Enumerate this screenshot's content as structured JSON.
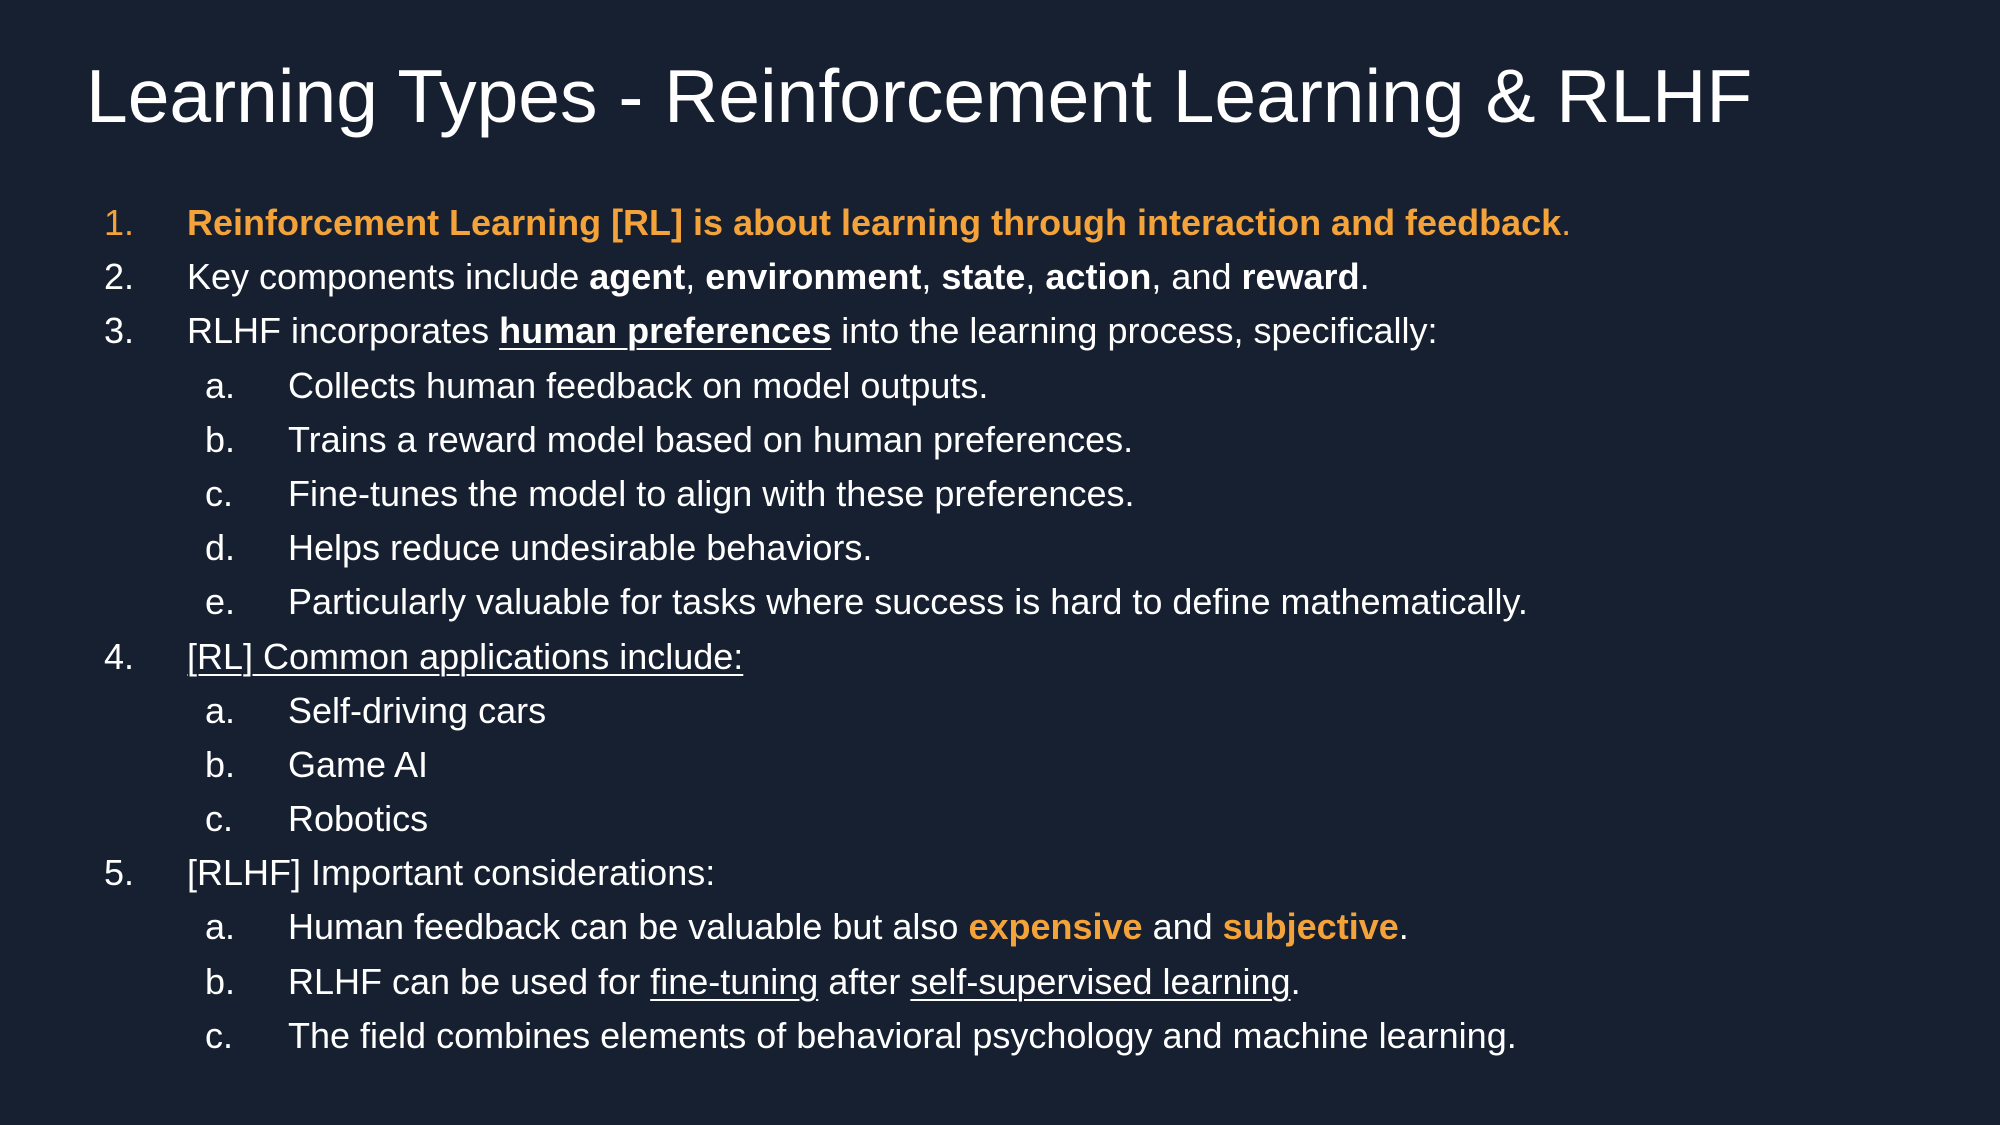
{
  "slide": {
    "title": "Learning Types - Reinforcement Learning & RLHF",
    "colors": {
      "background": "#172030",
      "text": "#ffffff",
      "accent": "#f4a33a"
    },
    "items": [
      {
        "num": "1.",
        "p0": "Reinforcement Learning [RL] is about learning through interaction and feedback",
        "p1": "."
      },
      {
        "num": "2.",
        "p0": "Key components include ",
        "p1": "agent",
        "p2": ", ",
        "p3": "environment",
        "p4": ", ",
        "p5": "state",
        "p6": ", ",
        "p7": "action",
        "p8": ", and ",
        "p9": "reward",
        "p10": "."
      },
      {
        "num": "3.",
        "p0": "RLHF incorporates ",
        "p1": "human preferences",
        "p2": " into the learning process, specifically:",
        "subs": [
          {
            "letter": "a.",
            "text": "Collects human feedback on model outputs."
          },
          {
            "letter": "b.",
            "text": "Trains a reward model based on human preferences."
          },
          {
            "letter": "c.",
            "text": "Fine-tunes the model to align with these preferences."
          },
          {
            "letter": "d.",
            "text": "Helps reduce undesirable behaviors."
          },
          {
            "letter": "e.",
            "text": "Particularly valuable for tasks where success is hard to define mathematically."
          }
        ]
      },
      {
        "num": "4.",
        "p0": "[RL] Common applications include:",
        "subs": [
          {
            "letter": "a.",
            "text": "Self-driving cars"
          },
          {
            "letter": "b.",
            "text": "Game AI"
          },
          {
            "letter": "c.",
            "text": "Robotics"
          }
        ]
      },
      {
        "num": "5.",
        "p0": "[RLHF] Important considerations:",
        "subs": [
          {
            "letter": "a.",
            "p0": "Human feedback can be valuable but also ",
            "p1": "expensive",
            "p2": " and ",
            "p3": "subjective",
            "p4": "."
          },
          {
            "letter": "b.",
            "p0": "RLHF can be used for ",
            "p1": "fine-tuning",
            "p2": " after ",
            "p3": "self-supervised learning",
            "p4": "."
          },
          {
            "letter": "c.",
            "text": "The field combines elements of behavioral psychology and machine learning."
          }
        ]
      }
    ]
  }
}
